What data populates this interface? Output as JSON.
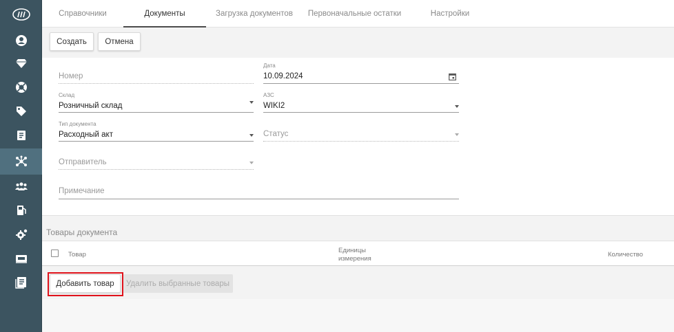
{
  "tabs": [
    {
      "label": "Справочники",
      "active": false
    },
    {
      "label": "Документы",
      "active": true
    },
    {
      "label": "Загрузка документов",
      "active": false
    },
    {
      "label": "Первоначальные остатки",
      "active": false
    },
    {
      "label": "Настройки",
      "active": false
    }
  ],
  "toolbar": {
    "create_label": "Создать",
    "cancel_label": "Отмена"
  },
  "form": {
    "number": {
      "placeholder": "Номер"
    },
    "date": {
      "label": "Дата",
      "value": "10.09.2024"
    },
    "warehouse": {
      "label": "Склад",
      "value": "Розничный склад"
    },
    "station": {
      "label": "АЗС",
      "value": "WIKI2"
    },
    "doc_type": {
      "label": "Тип документа",
      "value": "Расходный акт"
    },
    "status": {
      "placeholder": "Статус"
    },
    "sender": {
      "placeholder": "Отправитель"
    },
    "note": {
      "placeholder": "Примечание"
    }
  },
  "goods": {
    "section_title": "Товары документа",
    "columns": {
      "product": "Товар",
      "units_line1": "Единицы",
      "units_line2": "измерения",
      "quantity": "Количество"
    },
    "add_label": "Добавить товар",
    "delete_label": "Удалить выбранные товары"
  },
  "sidebar": {
    "icons": [
      "logo-icon",
      "user-icon",
      "diamond-icon",
      "lifebuoy-icon",
      "tag-icon",
      "receipt-icon",
      "network-icon",
      "group-icon",
      "fuel-pump-icon",
      "settings-gear-icon",
      "cash-icon",
      "list-doc-icon"
    ],
    "active_index": 6
  },
  "colors": {
    "sidebar": "#3c5460",
    "sidebar_active": "#50707f",
    "highlight": "#e0121b"
  }
}
